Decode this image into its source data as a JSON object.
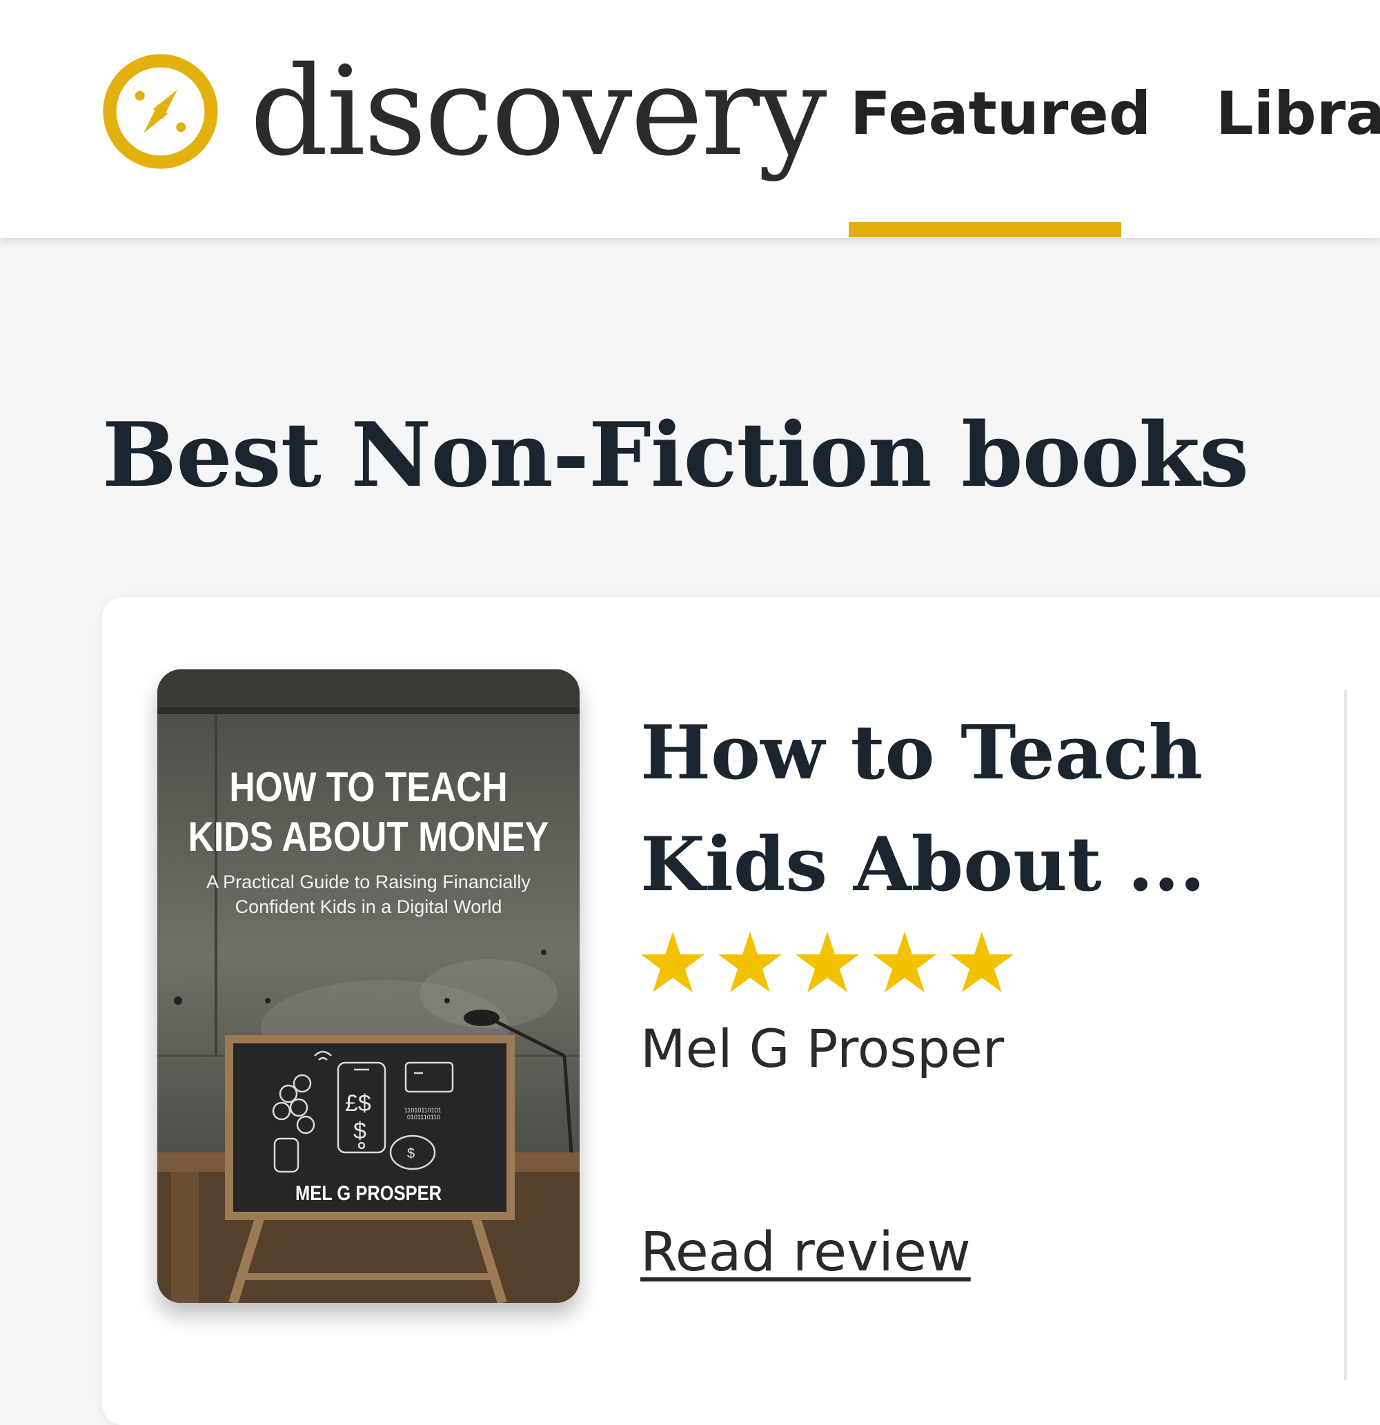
{
  "header": {
    "logo_text": "discovery",
    "logo_icon": "compass-icon",
    "accent_color": "#e3ad12",
    "nav": [
      {
        "label": "Featured",
        "active": true
      },
      {
        "label": "Librar"
      }
    ]
  },
  "section": {
    "title": "Best Non-Fiction books"
  },
  "book": {
    "title": "How to Teach Kids About ...",
    "rating_stars": 5,
    "rating_max": 5,
    "star_color": "#f2c200",
    "author": "Mel G Prosper",
    "link_label": "Read review",
    "cover": {
      "title": "HOW TO TEACH KIDS ABOUT MONEY",
      "subtitle": "A Practical Guide to Raising Financially Confident Kids in a Digital World",
      "author": "MEL G PROSPER"
    }
  }
}
